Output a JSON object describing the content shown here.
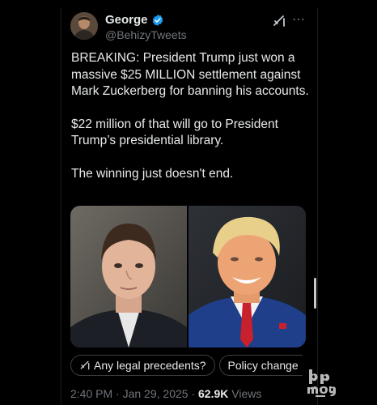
{
  "post": {
    "author_name": "George",
    "author_handle": "@BehizyTweets",
    "paragraphs": [
      "BREAKING: President Trump just won a massive $25 MILLION settlement against Mark Zuckerberg for banning his accounts.",
      "$22 million of that will go to President Trump’s presidential library.",
      "The winning just doesn't end."
    ]
  },
  "suggestions": [
    {
      "label": "Any legal precedents?",
      "icon": "grok-icon"
    },
    {
      "label": "Policy change"
    }
  ],
  "meta": {
    "time": "2:40 PM",
    "sep1": " · ",
    "date": "Jan 29, 2025",
    "sep2": " · ",
    "views_count": "62.9K",
    "views_label": " Views"
  },
  "colors": {
    "background": "#000000",
    "text": "#e7e9ea",
    "secondary": "#71767b",
    "verified": "#1d9bf0",
    "chip_border": "#3a3f44"
  },
  "icons": [
    "verified-badge-icon",
    "grok-icon",
    "more-icon"
  ]
}
